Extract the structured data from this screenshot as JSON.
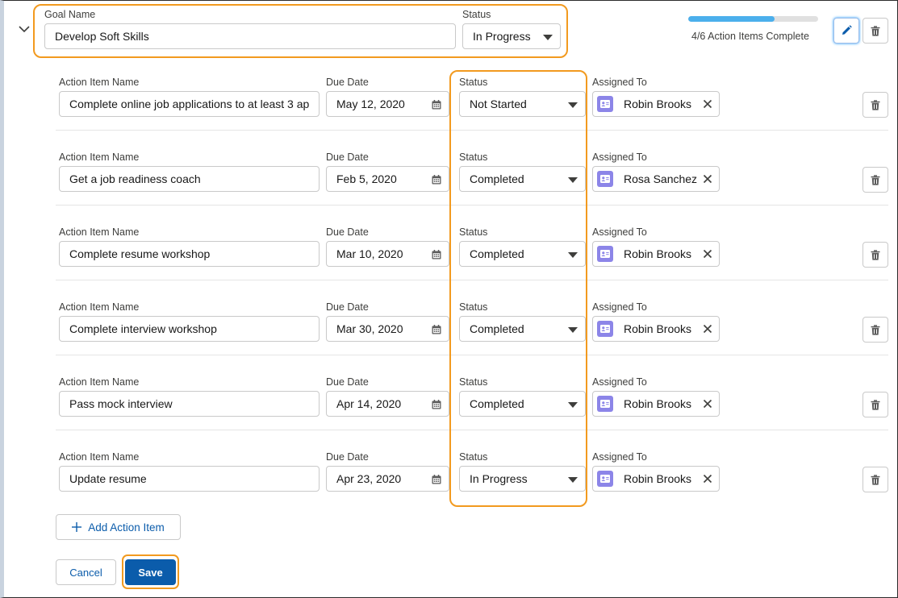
{
  "goal": {
    "name_label": "Goal Name",
    "name_value": "Develop Soft Skills",
    "status_label": "Status",
    "status_value": "In Progress",
    "progress_text": "4/6 Action Items Complete",
    "progress_fraction": 0.667
  },
  "labels": {
    "action_item_name": "Action Item Name",
    "due_date": "Due Date",
    "status": "Status",
    "assigned_to": "Assigned To"
  },
  "action_items": [
    {
      "name": "Complete online job applications to at least 3 ap",
      "due": "May 12, 2020",
      "status": "Not Started",
      "assignee": "Robin Brooks"
    },
    {
      "name": "Get a job readiness coach",
      "due": "Feb 5, 2020",
      "status": "Completed",
      "assignee": "Rosa Sanchez"
    },
    {
      "name": "Complete resume workshop",
      "due": "Mar 10, 2020",
      "status": "Completed",
      "assignee": "Robin Brooks"
    },
    {
      "name": "Complete interview workshop",
      "due": "Mar 30, 2020",
      "status": "Completed",
      "assignee": "Robin Brooks"
    },
    {
      "name": "Pass mock interview",
      "due": "Apr 14, 2020",
      "status": "Completed",
      "assignee": "Robin Brooks"
    },
    {
      "name": "Update resume",
      "due": "Apr 23, 2020",
      "status": "In Progress",
      "assignee": "Robin Brooks"
    }
  ],
  "buttons": {
    "add_action_item": "Add Action Item",
    "cancel": "Cancel",
    "save": "Save"
  },
  "colors": {
    "accent": "#0176d3",
    "save_bg": "#0b5cab",
    "highlight": "#f29a1f",
    "progress": "#4bafec",
    "contact_badge": "#8c85e8"
  },
  "icons": {
    "collapse": "chevron-down-icon",
    "edit": "pencil-icon",
    "delete": "trash-icon",
    "calendar": "calendar-icon",
    "contact": "contact-card-icon",
    "clear": "close-icon",
    "add": "plus-icon"
  }
}
